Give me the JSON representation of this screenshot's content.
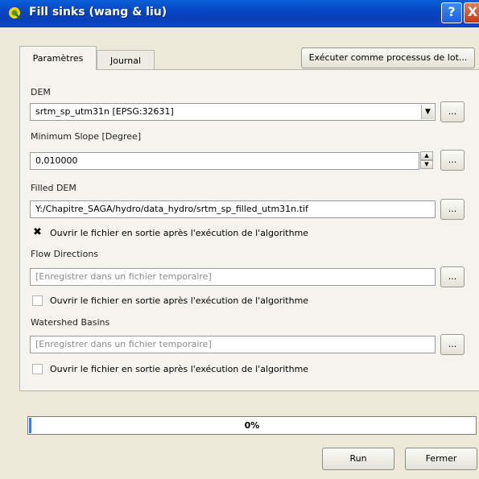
{
  "window": {
    "title": "Fill sinks (wang & liu)",
    "help_label": "?",
    "close_label": "X"
  },
  "tabs": [
    {
      "label": "Paramètres",
      "active": true
    },
    {
      "label": "Journal",
      "active": false
    }
  ],
  "batch_button": "Exécuter comme processus de lot...",
  "params": {
    "dem": {
      "label": "DEM",
      "value": "srtm_sp_utm31n [EPSG:32631]",
      "button": "..."
    },
    "min_slope": {
      "label": "Minimum Slope [Degree]",
      "value": "0,010000",
      "button": "..."
    },
    "filled_dem": {
      "label": "Filled DEM",
      "value": "Y:/Chapitre_SAGA/hydro/data_hydro/srtm_sp_filled_utm31n.tif",
      "button": "...",
      "open_checked": true,
      "open_label": "Ouvrir le fichier en sortie après l'exécution de l'algorithme"
    },
    "flow_directions": {
      "label": "Flow Directions",
      "placeholder": "[Enregistrer dans un fichier temporaire]",
      "button": "...",
      "open_checked": false,
      "open_label": "Ouvrir le fichier en sortie après l'exécution de l'algorithme"
    },
    "watershed_basins": {
      "label": "Watershed Basins",
      "placeholder": "[Enregistrer dans un fichier temporaire]",
      "button": "...",
      "open_checked": false,
      "open_label": "Ouvrir le fichier en sortie après l'exécution de l'algorithme"
    }
  },
  "progress": {
    "percent": 0,
    "label": "0%"
  },
  "buttons": {
    "run": "Run",
    "close": "Fermer"
  },
  "colors": {
    "titlebar": "#0747c4",
    "dialog_bg": "#ece9d8",
    "progress_fill": "#3f7be0"
  }
}
